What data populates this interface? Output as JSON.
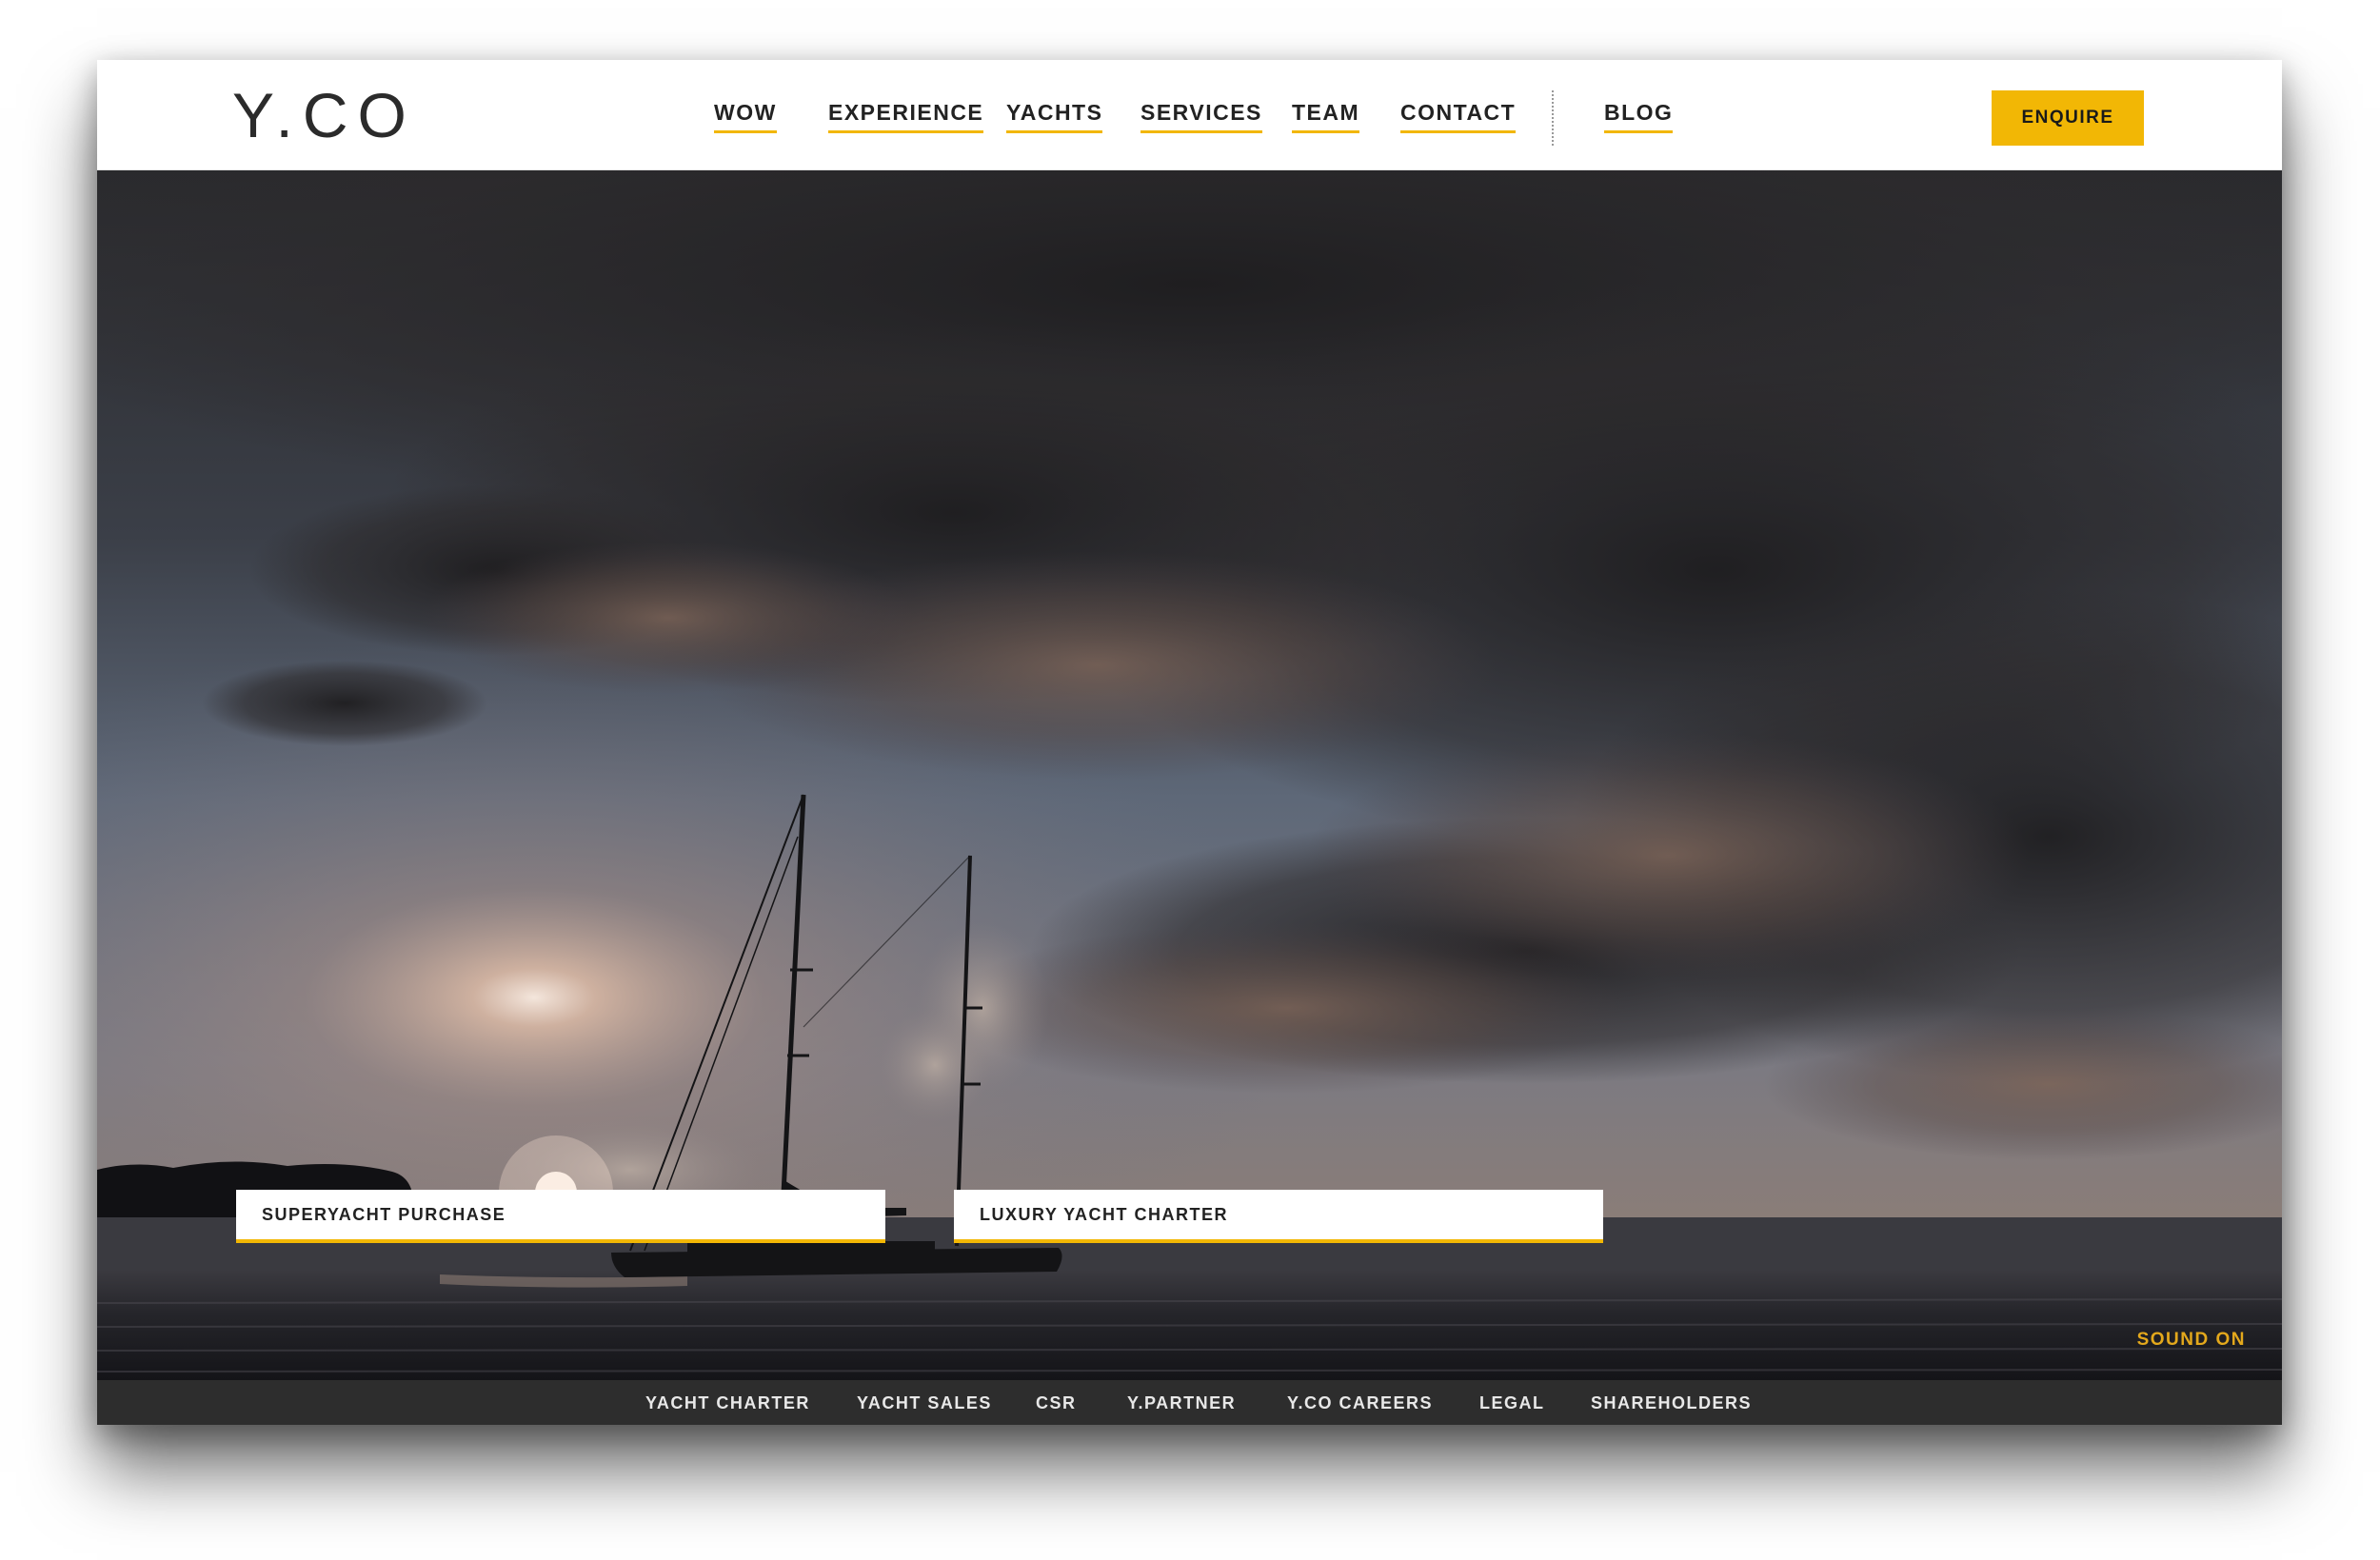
{
  "brand": {
    "logo_text": "Y.CO",
    "accent_color": "#f2b705"
  },
  "nav": {
    "items": [
      {
        "label": "WOW"
      },
      {
        "label": "EXPERIENCE"
      },
      {
        "label": "YACHTS"
      },
      {
        "label": "SERVICES"
      },
      {
        "label": "TEAM"
      },
      {
        "label": "CONTACT"
      },
      {
        "label": "BLOG"
      }
    ],
    "enquire_label": "ENQUIRE"
  },
  "hero": {
    "ctas": [
      {
        "label": "SUPERYACHT PURCHASE"
      },
      {
        "label": "LUXURY YACHT CHARTER"
      }
    ],
    "sound_label": "SOUND ON"
  },
  "footer": {
    "links": [
      {
        "label": "YACHT CHARTER"
      },
      {
        "label": "YACHT SALES"
      },
      {
        "label": "CSR"
      },
      {
        "label": "Y.PARTNER"
      },
      {
        "label": "Y.CO CAREERS"
      },
      {
        "label": "LEGAL"
      },
      {
        "label": "SHAREHOLDERS"
      }
    ]
  }
}
